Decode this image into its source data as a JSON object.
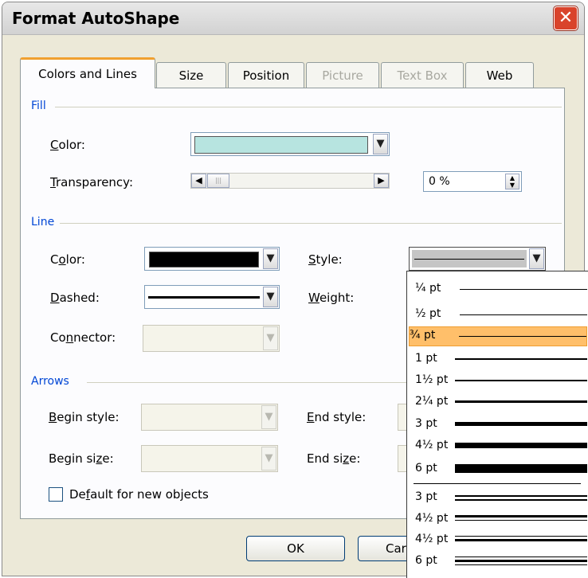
{
  "dialog": {
    "title": "Format AutoShape",
    "close_glyph": "✕"
  },
  "tabs": [
    {
      "label": "Colors and Lines",
      "state": "active"
    },
    {
      "label": "Size",
      "state": "normal"
    },
    {
      "label": "Position",
      "state": "normal"
    },
    {
      "label": "Picture",
      "state": "disabled"
    },
    {
      "label": "Text Box",
      "state": "disabled"
    },
    {
      "label": "Web",
      "state": "normal"
    }
  ],
  "fill": {
    "section": "Fill",
    "color_label_u": "C",
    "color_label_rest": "olor:",
    "color_value": "#b7e4e0",
    "transparency_label_u": "T",
    "transparency_label_rest": "ransparency:",
    "transparency_value": "0 %",
    "transparency_level_percent": 0
  },
  "line": {
    "section": "Line",
    "color_label_pre": "C",
    "color_label_u": "o",
    "color_label_rest": "lor:",
    "color_value": "#000000",
    "style_label_u": "S",
    "style_label_rest": "tyle:",
    "dashed_label_u": "D",
    "dashed_label_rest": "ashed:",
    "weight_label_u": "W",
    "weight_label_rest": "eight:",
    "connector_label_pre": "Co",
    "connector_label_u": "n",
    "connector_label_rest": "nector:"
  },
  "arrows": {
    "section": "Arrows",
    "begin_style_label_u": "B",
    "begin_style_label_rest": "egin style:",
    "end_style_label_u": "E",
    "end_style_label_rest": "nd style:",
    "begin_size_label_pre": "Begin si",
    "begin_size_label_u": "z",
    "begin_size_label_rest": "e:",
    "end_size_label_pre": "End si",
    "end_size_label_u": "z",
    "end_size_label_rest": "e:"
  },
  "default_checkbox": {
    "label_pre": "De",
    "label_u": "f",
    "label_rest": "ault for new objects",
    "checked": false
  },
  "buttons": {
    "ok": "OK",
    "cancel": "Car"
  },
  "style_dropdown": {
    "items": [
      {
        "label": "¼ pt"
      },
      {
        "label": "½ pt"
      },
      {
        "label": "¾ pt",
        "selected": true
      },
      {
        "label": "1 pt"
      },
      {
        "label": "1½ pt"
      },
      {
        "label": "2¼ pt"
      },
      {
        "label": "3 pt"
      },
      {
        "label": "4½ pt"
      },
      {
        "label": "6 pt"
      },
      {
        "label": "3 pt"
      },
      {
        "label": "4½ pt"
      },
      {
        "label": "4½ pt"
      },
      {
        "label": "6 pt"
      }
    ]
  },
  "colors": {
    "section_text": "#0046d5",
    "selection_bg": "#ffbf6a",
    "close_button": "#d9432b"
  }
}
